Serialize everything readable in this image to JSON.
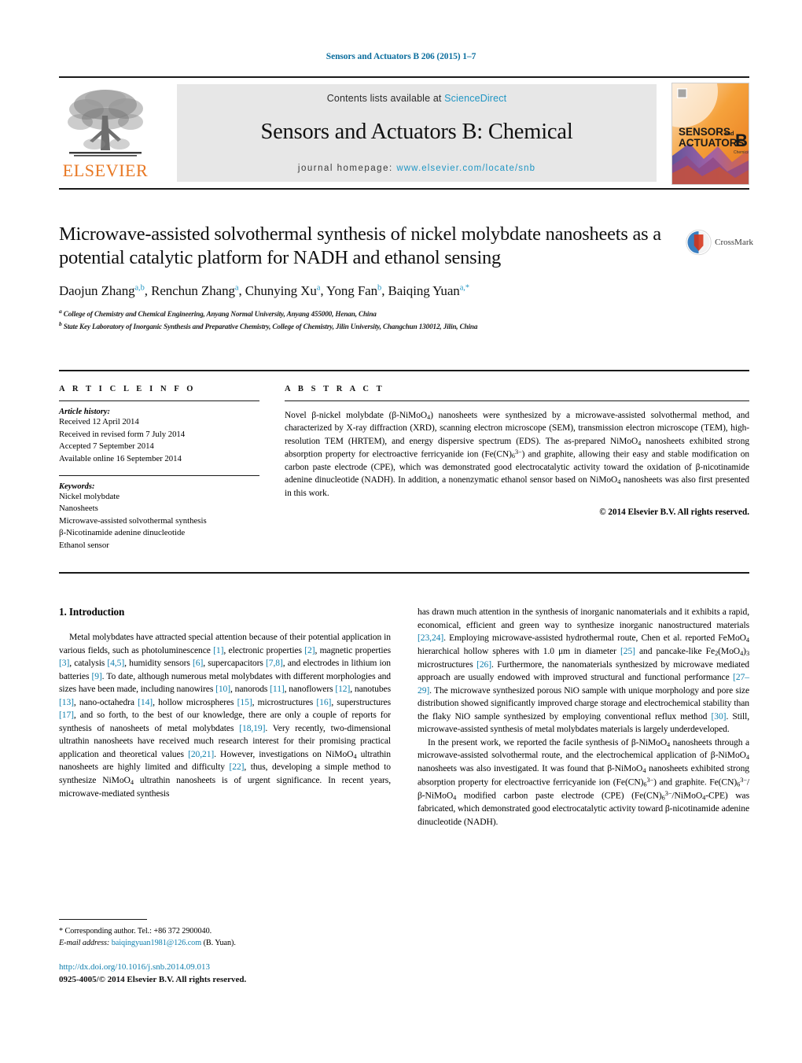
{
  "running_head": "Sensors and Actuators B 206 (2015) 1–7",
  "masthead": {
    "contents_text": "Contents lists available at",
    "sciencedirect_link": "ScienceDirect",
    "journal_title": "Sensors and Actuators B: Chemical",
    "homepage_label": "journal homepage:",
    "homepage_link": "www.elsevier.com/locate/snb",
    "publisher_wordmark": "ELSEVIER",
    "publisher_color": "#E87722",
    "link_color": "#2196c4",
    "cover": {
      "line1": "SENSORS",
      "line1_small": "and",
      "line2": "ACTUATORS",
      "letter": "B",
      "letter_sub": "Chemical"
    }
  },
  "crossmark": {
    "label": "CrossMark"
  },
  "article": {
    "title": "Microwave-assisted solvothermal synthesis of nickel molybdate nanosheets as a potential catalytic platform for NADH and ethanol sensing",
    "authors_html": "Daojun Zhang<sup>a,b</sup>, Renchun Zhang<sup>a</sup>, Chunying Xu<sup>a</sup>, Yong Fan<sup>b</sup>, Baiqing Yuan<sup>a,</sup><sup>*</sup>",
    "affiliations": [
      "College of Chemistry and Chemical Engineering, Anyang Normal University, Anyang 455000, Henan, China",
      "State Key Laboratory of Inorganic Synthesis and Preparative Chemistry, College of Chemistry, Jilin University, Changchun 130012, Jilin, China"
    ],
    "affiliation_markers": [
      "a",
      "b"
    ]
  },
  "article_info": {
    "heading": "A R T I C L E    I N F O",
    "history_label": "Article history:",
    "history": [
      "Received 12 April 2014",
      "Received in revised form 7 July 2014",
      "Accepted 7 September 2014",
      "Available online 16 September 2014"
    ],
    "keywords_label": "Keywords:",
    "keywords": [
      "Nickel molybdate",
      "Nanosheets",
      "Microwave-assisted solvothermal synthesis",
      "β-Nicotinamide adenine dinucleotide",
      "Ethanol sensor"
    ]
  },
  "abstract": {
    "heading": "A B S T R A C T",
    "body_html": "Novel β-nickel molybdate (β-NiMoO<sub>4</sub>) nanosheets were synthesized by a microwave-assisted solvothermal method, and characterized by X-ray diffraction (XRD), scanning electron microscope (SEM), transmission electron microscope (TEM), high-resolution TEM (HRTEM), and energy dispersive spectrum (EDS). The as-prepared NiMoO<sub>4</sub> nanosheets exhibited strong absorption property for electroactive ferricyanide ion (Fe(CN)<sub>6</sub><sup class=\"chg\">3−</sup>) and graphite, allowing their easy and stable modification on carbon paste electrode (CPE), which was demonstrated good electrocatalytic activity toward the oxidation of β-nicotinamide adenine dinucleotide (NADH). In addition, a nonenzymatic ethanol sensor based on NiMoO<sub>4</sub> nanosheets was also first presented in this work.",
    "copyright": "© 2014 Elsevier B.V. All rights reserved."
  },
  "body": {
    "section_number_title": "1.  Introduction",
    "left_paragraph_html": "Metal molybdates have attracted special attention because of their potential application in various fields, such as photoluminescence <span class=\"ref\">[1]</span>, electronic properties <span class=\"ref\">[2]</span>, magnetic properties <span class=\"ref\">[3]</span>, catalysis <span class=\"ref\">[4,5]</span>, humidity sensors <span class=\"ref\">[6]</span>, supercapacitors <span class=\"ref\">[7,8]</span>, and electrodes in lithium ion batteries <span class=\"ref\">[9]</span>. To date, although numerous metal molybdates with different morphologies and sizes have been made, including nanowires <span class=\"ref\">[10]</span>, nanorods <span class=\"ref\">[11]</span>, nanoflowers <span class=\"ref\">[12]</span>, nanotubes <span class=\"ref\">[13]</span>, nano-octahedra <span class=\"ref\">[14]</span>, hollow microspheres <span class=\"ref\">[15]</span>, microstructures <span class=\"ref\">[16]</span>, superstructures <span class=\"ref\">[17]</span>, and so forth, to the best of our knowledge, there are only a couple of reports for synthesis of nanosheets of metal molybdates <span class=\"ref\">[18,19]</span>. Very recently, two-dimensional ultrathin nanosheets have received much research interest for their promising practical application and theoretical values <span class=\"ref\">[20,21]</span>. However, investigations on NiMoO<sub>4</sub> ultrathin nanosheets are highly limited and difficulty <span class=\"ref\">[22]</span>, thus, developing a simple method to synthesize NiMoO<sub>4</sub> ultrathin nanosheets is of urgent significance. In recent years, microwave-mediated synthesis",
    "right_paragraph_1_html": "has drawn much attention in the synthesis of inorganic nanomaterials and it exhibits a rapid, economical, efficient and green way to synthesize inorganic nanostructured materials <span class=\"ref\">[23,24]</span>. Employing microwave-assisted hydrothermal route, Chen et al. reported FeMoO<sub>4</sub> hierarchical hollow spheres with 1.0 μm in diameter <span class=\"ref\">[25]</span> and pancake-like Fe<sub>2</sub>(MoO<sub>4</sub>)<sub>3</sub> microstructures <span class=\"ref\">[26]</span>. Furthermore, the nanomaterials synthesized by microwave mediated approach are usually endowed with improved structural and functional performance <span class=\"ref\">[27–29]</span>. The microwave synthesized porous NiO sample with unique morphology and pore size distribution showed significantly improved charge storage and electrochemical stability than the flaky NiO sample synthesized by employing conventional reflux method <span class=\"ref\">[30]</span>. Still, microwave-assisted synthesis of metal molybdates materials is largely underdeveloped.",
    "right_paragraph_2_html": "In the present work, we reported the facile synthesis of β-NiMoO<sub>4</sub> nanosheets through a microwave-assisted solvothermal route, and the electrochemical application of β-NiMoO<sub>4</sub> nanosheets was also investigated. It was found that β-NiMoO<sub>4</sub> nanosheets exhibited strong absorption property for electroactive ferricyanide ion (Fe(CN)<sub>6</sub><sup class=\"chg\">3−</sup>) and graphite. Fe(CN)<sub>6</sub><sup class=\"chg\">3−</sup>/β-NiMoO<sub>4</sub> modified carbon paste electrode (CPE) (Fe(CN)<sub>6</sub><sup class=\"chg\">3−</sup>/NiMoO<sub>4</sub>-CPE) was fabricated, which demonstrated good electrocatalytic activity toward β-nicotinamide adenine dinucleotide (NADH)."
  },
  "footer": {
    "corresponding_html": "*  Corresponding author. Tel.: +86 372 2900040.",
    "email_label": "E-mail address:",
    "email": "baiqingyuan1981@126.com",
    "email_suffix": "(B. Yuan).",
    "doi_url": "http://dx.doi.org/10.1016/j.snb.2014.09.013",
    "issn_line": "0925-4005/© 2014 Elsevier B.V. All rights reserved."
  }
}
